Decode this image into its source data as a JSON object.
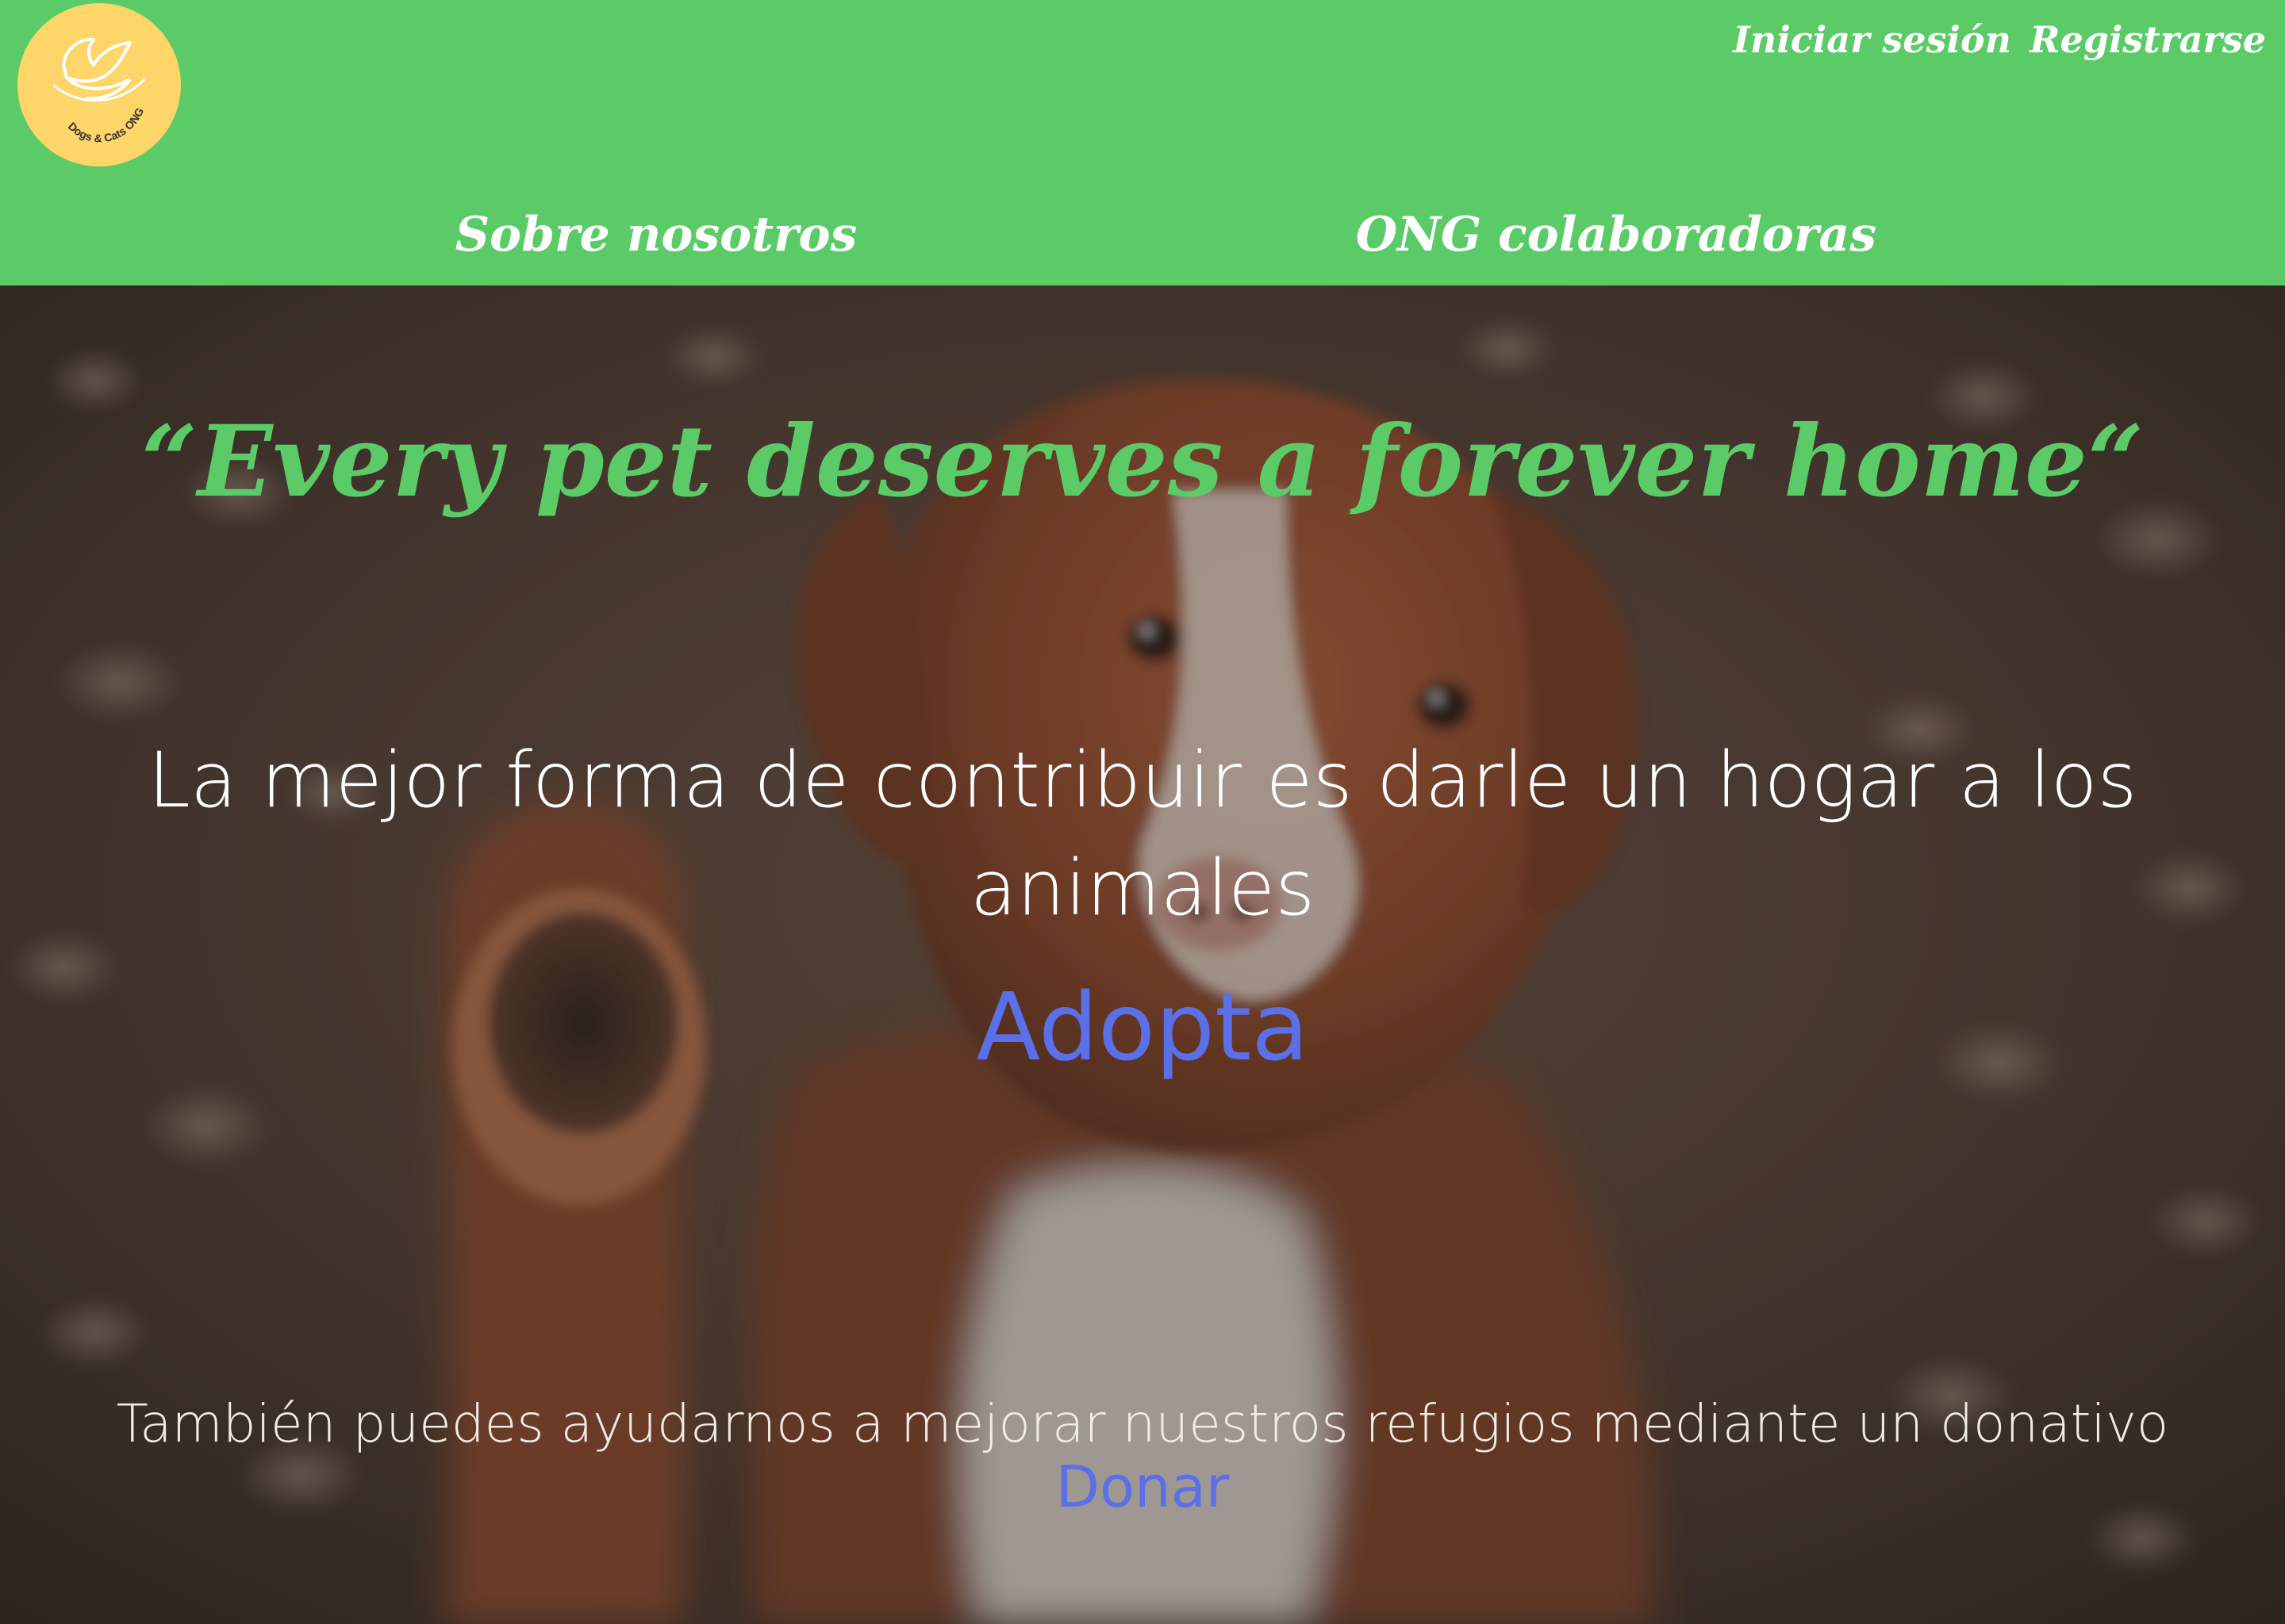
{
  "header": {
    "logo": {
      "icon": "dove-icon",
      "text": "Dogs & Cats ONG",
      "background_color": "#fdd568"
    },
    "auth": {
      "login_label": "Iniciar sesión",
      "register_label": "Registrarse"
    },
    "nav": {
      "about_label": "Sobre nosotros",
      "partners_label": "ONG colaboradoras"
    },
    "background_color": "#5bcb68"
  },
  "hero": {
    "background_image": "brown-dog-raising-paw-photo",
    "tagline": "“Every pet deserves a forever home“",
    "headline": "La mejor forma de contribuir es darle un hogar a los animales",
    "adopt_label": "Adopta",
    "donate_text": "También puedes ayudarnos a mejorar nuestros refugios mediante un donativo",
    "donate_label": "Donar",
    "tagline_color": "#5bcb68",
    "link_color": "#5b6fe8"
  }
}
